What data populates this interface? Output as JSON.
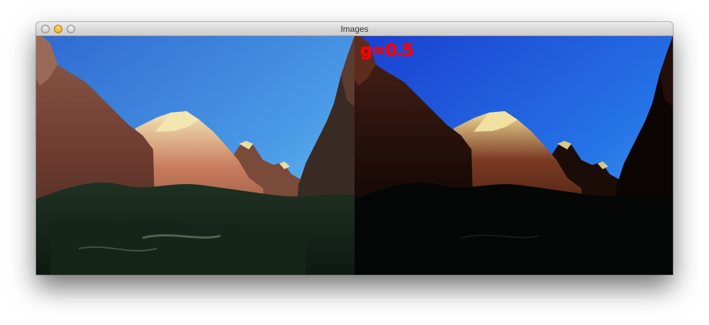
{
  "window": {
    "title": "Images"
  },
  "panels": {
    "original": {
      "description_name": "original-image"
    },
    "adjusted": {
      "label": "g=0.5",
      "label_color": "#ff0000"
    }
  },
  "colors": {
    "sky_top_left": "#2f6fd6",
    "sky_bottom_left": "#6ec1ef",
    "sky_top_right": "#1a44d6",
    "sky_bottom_right": "#47a9ef"
  }
}
